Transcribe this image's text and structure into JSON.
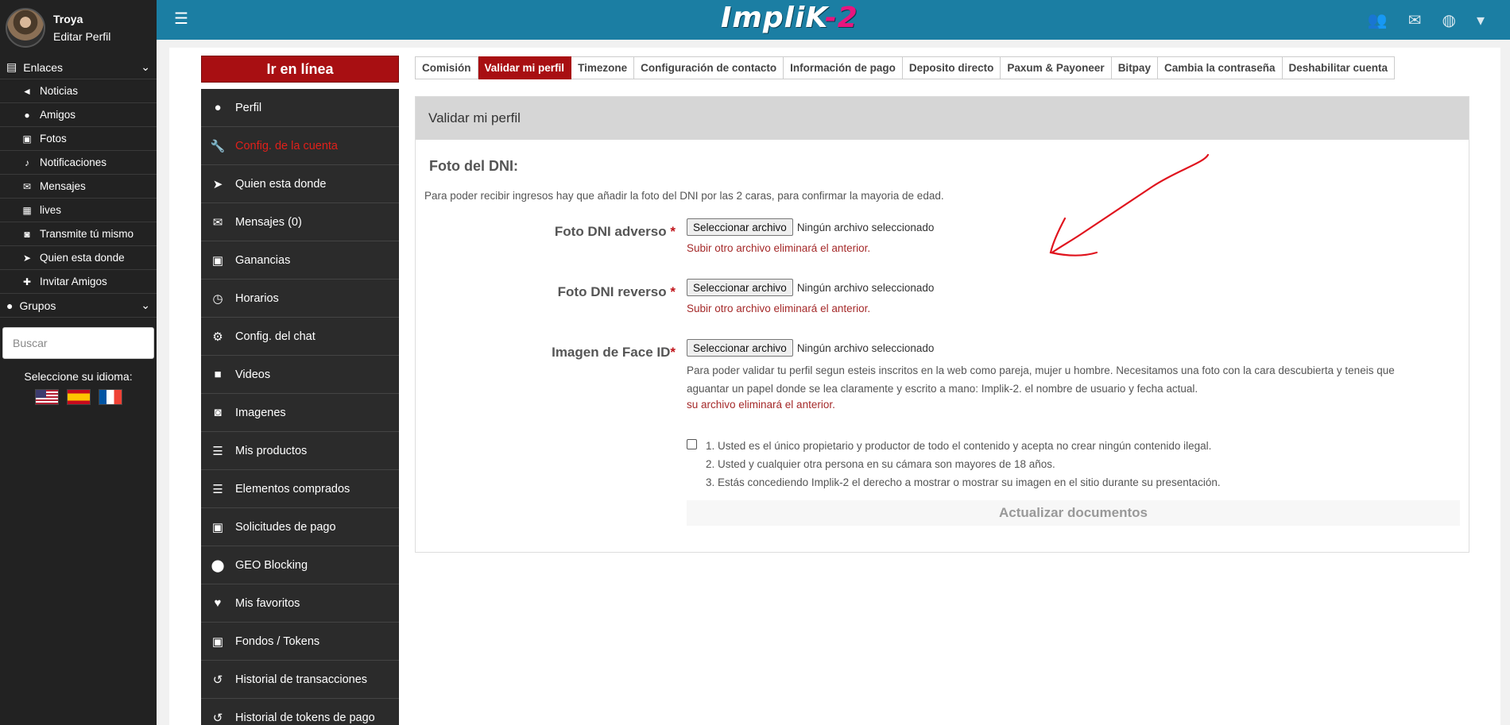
{
  "user": {
    "name": "Troya",
    "edit_profile": "Editar Perfil"
  },
  "sidebar": {
    "links_group": "Enlaces",
    "items": [
      {
        "label": "Noticias",
        "icon": "bullhorn-icon"
      },
      {
        "label": "Amigos",
        "icon": "users-icon"
      },
      {
        "label": "Fotos",
        "icon": "image-icon"
      },
      {
        "label": "Notificaciones",
        "icon": "bell-icon"
      },
      {
        "label": "Mensajes",
        "icon": "envelope-icon"
      },
      {
        "label": "lives",
        "icon": "film-icon"
      },
      {
        "label": "Transmite tú mismo",
        "icon": "camera-icon"
      },
      {
        "label": "Quien esta donde",
        "icon": "location-arrow-icon"
      },
      {
        "label": "Invitar Amigos",
        "icon": "user-plus-icon"
      }
    ],
    "groups_label": "Grupos",
    "search_placeholder": "Buscar",
    "language_label": "Seleccione su idioma:"
  },
  "header": {
    "logo_white": "ImpliK",
    "logo_pink": "-2"
  },
  "account_menu": {
    "go_online": "Ir en línea",
    "items": [
      {
        "label": "Perfil",
        "icon": "user-icon"
      },
      {
        "label": "Config. de la cuenta",
        "icon": "wrench-icon",
        "active": true
      },
      {
        "label": "Quien esta donde",
        "icon": "location-arrow-icon"
      },
      {
        "label": "Mensajes (0)",
        "icon": "envelope-icon"
      },
      {
        "label": "Ganancias",
        "icon": "money-icon"
      },
      {
        "label": "Horarios",
        "icon": "clock-icon"
      },
      {
        "label": "Config. del chat",
        "icon": "cogs-icon"
      },
      {
        "label": "Videos",
        "icon": "video-camera-icon"
      },
      {
        "label": "Imagenes",
        "icon": "camera-icon"
      },
      {
        "label": "Mis productos",
        "icon": "list-icon"
      },
      {
        "label": "Elementos comprados",
        "icon": "list-icon"
      },
      {
        "label": "Solicitudes de pago",
        "icon": "money-icon"
      },
      {
        "label": "GEO Blocking",
        "icon": "map-marker-icon"
      },
      {
        "label": "Mis favoritos",
        "icon": "heart-icon"
      },
      {
        "label": "Fondos / Tokens",
        "icon": "money-icon"
      },
      {
        "label": "Historial de transacciones",
        "icon": "history-icon"
      },
      {
        "label": "Historial de tokens de pago",
        "icon": "history-icon"
      }
    ]
  },
  "tabs": [
    {
      "label": "Comisión"
    },
    {
      "label": "Validar mi perfil",
      "active": true
    },
    {
      "label": "Timezone"
    },
    {
      "label": "Configuración de contacto"
    },
    {
      "label": "Información de pago"
    },
    {
      "label": "Deposito directo"
    },
    {
      "label": "Paxum & Payoneer"
    },
    {
      "label": "Bitpay"
    },
    {
      "label": "Cambia la contraseña"
    },
    {
      "label": "Deshabilitar cuenta"
    }
  ],
  "card": {
    "title": "Validar mi perfil",
    "section_title": "Foto del DNI:",
    "intro": "Para poder recibir ingresos hay que añadir la foto del DNI por las 2 caras, para confirmar la mayoria de edad.",
    "file_button": "Seleccionar archivo",
    "no_file": "Ningún archivo seleccionado",
    "fields": [
      {
        "label": "Foto DNI adverso",
        "hint": "Subir otro archivo eliminará el anterior."
      },
      {
        "label": "Foto DNI reverso",
        "hint": "Subir otro archivo eliminará el anterior."
      },
      {
        "label": "Imagen de Face ID",
        "hint": "su archivo eliminará el anterior."
      }
    ],
    "face_desc": "Para poder validar tu perfil segun esteis inscritos en la web como pareja, mujer u hombre. Necesitamos una foto con la cara descubierta y teneis que aguantar un papel donde se lea claramente y escrito a mano: Implik-2. el nombre de usuario y fecha actual.",
    "required_mark": "*",
    "terms": [
      "1. Usted es el único propietario y productor de todo el contenido y acepta no crear ningún contenido ilegal.",
      "2. Usted y cualquier otra persona en su cámara son mayores de 18 años.",
      "3. Estás concediendo Implik-2 el derecho a mostrar o mostrar su imagen en el sitio durante su presentación."
    ],
    "submit": "Actualizar documentos"
  },
  "colors": {
    "topbar": "#1b7ea3",
    "brand_red": "#a80f12",
    "sidebar_bg": "#222222",
    "annotation": "#e0141e"
  }
}
